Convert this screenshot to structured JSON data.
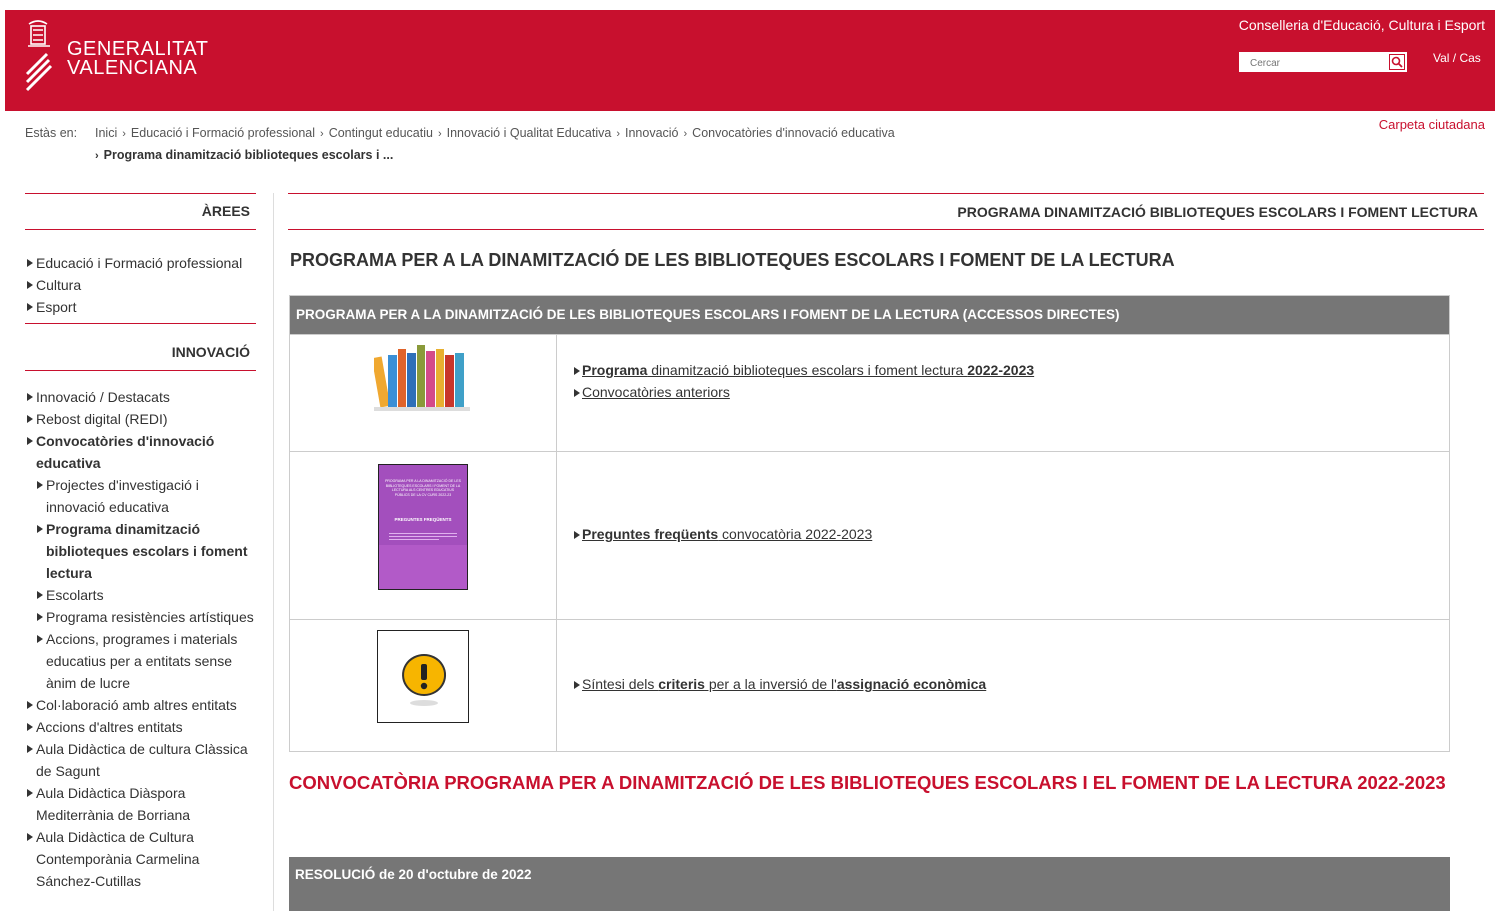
{
  "header": {
    "logo_line1": "GENERALITAT",
    "logo_line2": "VALENCIANA",
    "conselleria": "Conselleria d'Educació, Cultura i Esport",
    "search_placeholder": "Cercar",
    "lang": "Val / Cas",
    "accent_color": "#c8102e"
  },
  "breadcrumb": {
    "label": "Estàs en:",
    "items": [
      "Inici",
      "Educació i Formació professional",
      "Contingut educatiu",
      "Innovació i Qualitat Educativa",
      "Innovació",
      "Convocatòries d'innovació educativa"
    ],
    "current": "Programa dinamització biblioteques escolars i ...",
    "carpeta": "Carpeta ciutadana"
  },
  "sidebar": {
    "areas_title": "ÀREES",
    "areas": [
      "Educació i Formació professional",
      "Cultura",
      "Esport"
    ],
    "innovacio_title": "INNOVACIÓ",
    "items": [
      "Innovació / Destacats",
      "Rebost digital (REDI)",
      "Convocatòries d'innovació educativa",
      "Projectes d'investigació i innovació educativa",
      "Programa dinamització biblioteques escolars i foment lectura",
      "Escolarts",
      "Programa resistències artístiques",
      "Accions, programes i materials educatius per a entitats sense ànim de lucre",
      "Col·laboració amb altres entitats",
      "Accions d'altres entitats",
      "Aula Didàctica de cultura Clàssica de Sagunt",
      "Aula Didàctica Diàspora Mediterrània de Borriana",
      "Aula Didàctica de Cultura Contemporània Carmelina Sánchez-Cutillas"
    ]
  },
  "main": {
    "section_title": "PROGRAMA DINAMITZACIÓ BIBLIOTEQUES ESCOLARS I FOMENT LECTURA",
    "heading": "PROGRAMA PER A LA DINAMITZACIÓ DE LES BIBLIOTEQUES ESCOLARS I FOMENT DE LA LECTURA",
    "table_header": "PROGRAMA PER A LA DINAMITZACIÓ DE LES BIBLIOTEQUES ESCOLARS I FOMENT DE LA LECTURA (ACCESSOS DIRECTES)",
    "row1": {
      "link1_bold": "Programa",
      "link1_rest": " dinamització biblioteques escolars i foment lectura ",
      "link1_year": "2022-2023",
      "link2": "Convocatòries anteriors"
    },
    "row2": {
      "link_bold": "Preguntes freqüents",
      "link_rest": " convocatòria 2022-2023",
      "thumb_title": "PROGRAMA PER A LA DINAMITZACIÓ DE LES BIBLIOTEQUES ESCOLARS I FOMENT DE LA LECTURA ALS CENTRES EDUCATIUS PÚBLICS DE LA CV CURS 2022-23",
      "thumb_sub": "PREGUNTES FREQÜENTS"
    },
    "row3": {
      "t1": "Síntesi dels ",
      "t2": "criteris",
      "t3": " per a la inversió de l'",
      "t4": "assignació econòmica"
    },
    "heading2": "CONVOCATÒRIA PROGRAMA PER A DINAMITZACIÓ DE LES BIBLIOTEQUES ESCOLARS I EL FOMENT DE LA LECTURA 2022-2023",
    "resolucio": "RESOLUCIÓ de 20 d'octubre de 2022"
  }
}
